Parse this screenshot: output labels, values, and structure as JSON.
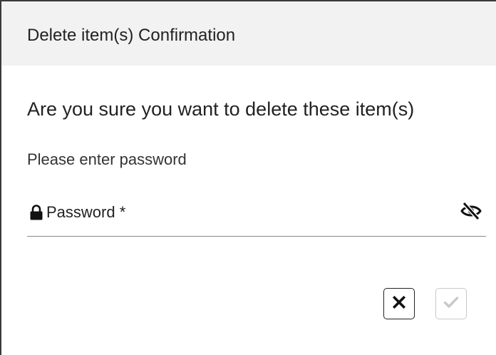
{
  "dialog": {
    "title": "Delete item(s) Confirmation",
    "message": "Are you sure you want to delete these item(s)",
    "prompt": "Please enter password",
    "password": {
      "label": "Password *",
      "value": "",
      "lock_icon": "lock-icon",
      "visibility_icon": "eye-slash-icon"
    },
    "buttons": {
      "cancel": {
        "icon": "close-icon",
        "enabled": true
      },
      "confirm": {
        "icon": "check-icon",
        "enabled": false
      }
    }
  },
  "colors": {
    "header_bg": "#f2f2f2",
    "text": "#222222",
    "border_dark": "#3a3a3a",
    "disabled": "#c8c8c8"
  }
}
